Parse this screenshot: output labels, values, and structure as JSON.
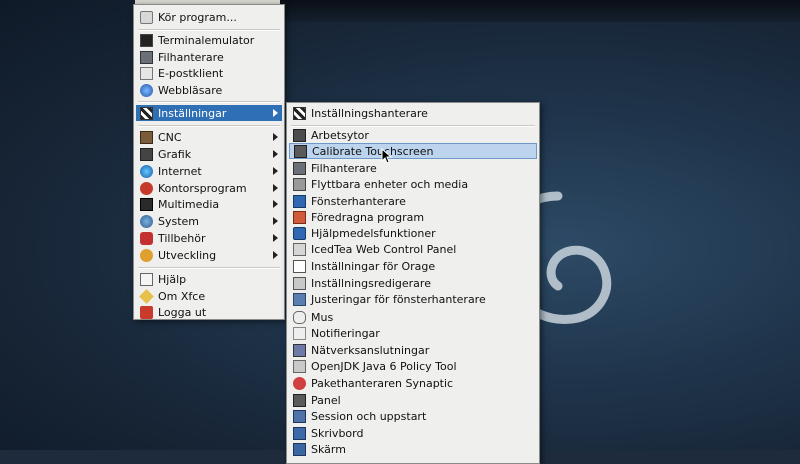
{
  "main_menu": {
    "items": [
      {
        "label": "Kör program...",
        "icon": "run-icon"
      },
      {
        "label": "Terminalemulator",
        "icon": "terminal-icon"
      },
      {
        "label": "Filhanterare",
        "icon": "file-manager-icon"
      },
      {
        "label": "E-postklient",
        "icon": "mail-icon"
      },
      {
        "label": "Webbläsare",
        "icon": "web-browser-icon"
      },
      {
        "label": "Inställningar",
        "icon": "settings-icon",
        "submenu": true
      },
      {
        "label": "CNC",
        "icon": "cnc-icon",
        "submenu": true
      },
      {
        "label": "Grafik",
        "icon": "graphics-icon",
        "submenu": true
      },
      {
        "label": "Internet",
        "icon": "internet-icon",
        "submenu": true
      },
      {
        "label": "Kontorsprogram",
        "icon": "office-icon",
        "submenu": true
      },
      {
        "label": "Multimedia",
        "icon": "multimedia-icon",
        "submenu": true
      },
      {
        "label": "System",
        "icon": "system-icon",
        "submenu": true
      },
      {
        "label": "Tillbehör",
        "icon": "accessories-icon",
        "submenu": true
      },
      {
        "label": "Utveckling",
        "icon": "development-icon",
        "submenu": true
      },
      {
        "label": "Hjälp",
        "icon": "help-icon"
      },
      {
        "label": "Om Xfce",
        "icon": "xfce-icon"
      },
      {
        "label": "Logga ut",
        "icon": "logout-icon"
      }
    ],
    "highlighted": "Inställningar"
  },
  "settings_submenu": {
    "items": [
      {
        "label": "Inställningshanterare",
        "icon": "settings-manager-icon"
      },
      {
        "label": "Arbetsytor",
        "icon": "workspaces-icon"
      },
      {
        "label": "Calibrate Touchscreen",
        "icon": "calibrate-icon"
      },
      {
        "label": "Filhanterare",
        "icon": "file-manager-icon"
      },
      {
        "label": "Flyttbara enheter och media",
        "icon": "removable-media-icon"
      },
      {
        "label": "Fönsterhanterare",
        "icon": "window-manager-icon"
      },
      {
        "label": "Föredragna program",
        "icon": "preferred-apps-icon"
      },
      {
        "label": "Hjälpmedelsfunktioner",
        "icon": "accessibility-icon"
      },
      {
        "label": "IcedTea Web Control Panel",
        "icon": "icedtea-icon"
      },
      {
        "label": "Inställningar för Orage",
        "icon": "orage-icon"
      },
      {
        "label": "Inställningsredigerare",
        "icon": "settings-editor-icon"
      },
      {
        "label": "Justeringar för fönsterhanterare",
        "icon": "wm-tweaks-icon"
      },
      {
        "label": "Mus",
        "icon": "mouse-icon"
      },
      {
        "label": "Notifieringar",
        "icon": "notifications-icon"
      },
      {
        "label": "Nätverksanslutningar",
        "icon": "network-connections-icon"
      },
      {
        "label": "OpenJDK Java 6 Policy Tool",
        "icon": "java-policy-icon"
      },
      {
        "label": "Pakethanteraren Synaptic",
        "icon": "synaptic-icon"
      },
      {
        "label": "Panel",
        "icon": "panel-icon"
      },
      {
        "label": "Session och uppstart",
        "icon": "session-icon"
      },
      {
        "label": "Skrivbord",
        "icon": "desktop-icon"
      },
      {
        "label": "Skärm",
        "icon": "display-icon"
      }
    ],
    "highlighted": "Calibrate Touchscreen"
  }
}
